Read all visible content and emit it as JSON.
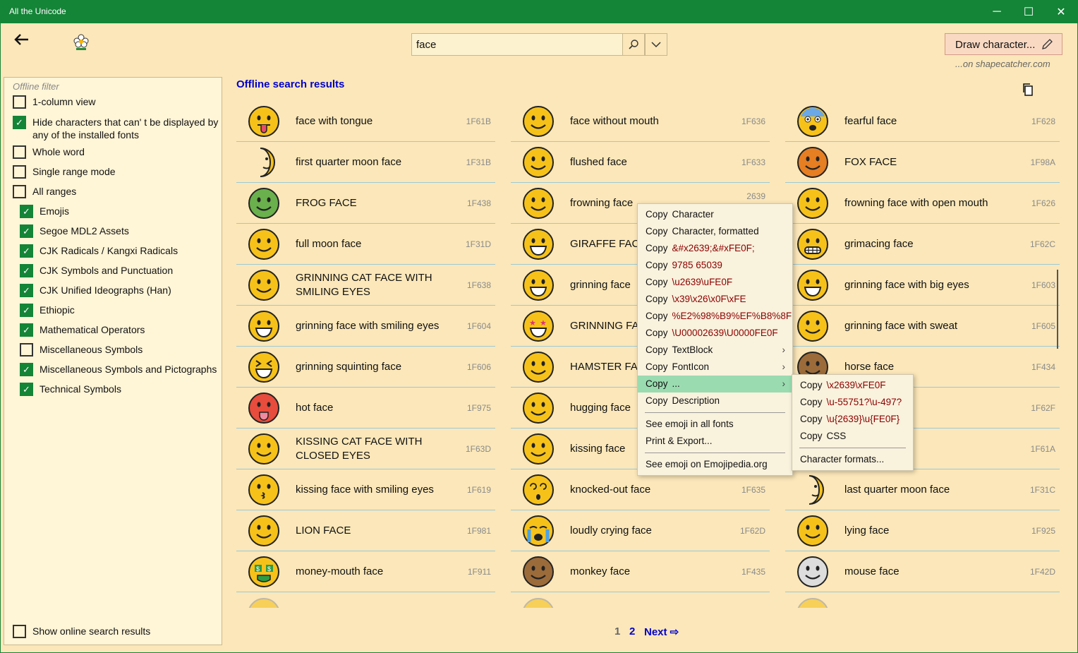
{
  "window": {
    "title": "All the Unicode"
  },
  "search": {
    "value": "face"
  },
  "draw": {
    "label": "Draw character...",
    "sub": "...on shapecatcher.com"
  },
  "filter": {
    "title": "Offline filter",
    "options": [
      {
        "label": "1-column view",
        "checked": false
      },
      {
        "label": "Hide characters that can' t be displayed by any of the installed fonts",
        "checked": true
      },
      {
        "label": "Whole word",
        "checked": false
      },
      {
        "label": "Single range mode",
        "checked": false
      },
      {
        "label": "All ranges",
        "checked": false
      }
    ],
    "ranges": [
      {
        "label": "Emojis",
        "checked": true
      },
      {
        "label": "Segoe MDL2 Assets",
        "checked": true
      },
      {
        "label": "CJK Radicals / Kangxi Radicals",
        "checked": true
      },
      {
        "label": "CJK Symbols and Punctuation",
        "checked": true
      },
      {
        "label": "CJK Unified Ideographs (Han)",
        "checked": true
      },
      {
        "label": "Ethiopic",
        "checked": true
      },
      {
        "label": "Mathematical Operators",
        "checked": true
      },
      {
        "label": "Miscellaneous Symbols",
        "checked": false
      },
      {
        "label": "Miscellaneous Symbols and Pictographs",
        "checked": true
      },
      {
        "label": "Technical Symbols",
        "checked": true
      }
    ],
    "online": {
      "label": "Show online search results",
      "checked": false
    }
  },
  "results": {
    "title": "Offline search results",
    "rows": [
      [
        [
          "face with tongue",
          "1F61B"
        ],
        [
          "face without mouth",
          "1F636"
        ],
        [
          "fearful face",
          "1F628"
        ]
      ],
      [
        [
          "first quarter moon face",
          "1F31B"
        ],
        [
          "flushed face",
          "1F633"
        ],
        [
          "FOX FACE",
          "1F98A"
        ]
      ],
      [
        [
          "FROG FACE",
          "1F438"
        ],
        [
          "frowning face",
          "2639"
        ],
        [
          "frowning face with open mouth",
          "1F626"
        ]
      ],
      [
        [
          "full moon face",
          "1F31D"
        ],
        [
          "GIRAFFE FACE",
          ""
        ],
        [
          "grimacing face",
          "1F62C"
        ]
      ],
      [
        [
          "GRINNING CAT FACE WITH SMILING EYES",
          "1F638"
        ],
        [
          "grinning face",
          ""
        ],
        [
          "grinning face with big eyes",
          "1F603"
        ]
      ],
      [
        [
          "grinning face with smiling eyes",
          "1F604"
        ],
        [
          "GRINNING FAC EYES",
          ""
        ],
        [
          "grinning face with sweat",
          "1F605"
        ]
      ],
      [
        [
          "grinning squinting face",
          "1F606"
        ],
        [
          "HAMSTER FAC",
          ""
        ],
        [
          "horse face",
          "1F434"
        ]
      ],
      [
        [
          "hot face",
          "1F975"
        ],
        [
          "hugging face",
          ""
        ],
        [
          "",
          "1F62F"
        ]
      ],
      [
        [
          "KISSING CAT FACE WITH CLOSED EYES",
          "1F63D"
        ],
        [
          "kissing face",
          ""
        ],
        [
          "h closed eyes",
          "1F61A"
        ]
      ],
      [
        [
          "kissing face with smiling eyes",
          "1F619"
        ],
        [
          "knocked-out face",
          "1F635"
        ],
        [
          "last quarter moon face",
          "1F31C"
        ]
      ],
      [
        [
          "LION FACE",
          "1F981"
        ],
        [
          "loudly crying face",
          "1F62D"
        ],
        [
          "lying face",
          "1F925"
        ]
      ],
      [
        [
          "money-mouth face",
          "1F911"
        ],
        [
          "monkey face",
          "1F435"
        ],
        [
          "mouse face",
          "1F42D"
        ]
      ]
    ]
  },
  "pager": {
    "p1": "1",
    "p2": "2",
    "next": "Next ⇨"
  },
  "context_menu": {
    "items": [
      {
        "k": "Copy",
        "v": "Character",
        "plain": true
      },
      {
        "k": "Copy",
        "v": "Character, formatted",
        "plain": true
      },
      {
        "k": "Copy",
        "v": "&#x2639;&#xFE0F;"
      },
      {
        "k": "Copy",
        "v": "9785 65039"
      },
      {
        "k": "Copy",
        "v": "\\u2639\\uFE0F"
      },
      {
        "k": "Copy",
        "v": "\\x39\\x26\\x0F\\xFE"
      },
      {
        "k": "Copy",
        "v": "%E2%98%B9%EF%B8%8F"
      },
      {
        "k": "Copy",
        "v": "\\U00002639\\U0000FE0F"
      },
      {
        "k": "Copy",
        "v": "TextBlock",
        "plain": true,
        "sub": true
      },
      {
        "k": "Copy",
        "v": "FontIcon",
        "plain": true,
        "sub": true
      },
      {
        "k": "Copy",
        "v": "...",
        "plain": true,
        "sub": true,
        "hl": true
      },
      {
        "k": "Copy",
        "v": "Description",
        "plain": true
      }
    ],
    "extra": [
      "See emoji in all fonts",
      "Print & Export..."
    ],
    "last": "See emoji on Emojipedia.org"
  },
  "submenu": {
    "items": [
      {
        "k": "Copy",
        "v": "\\x2639\\xFE0F"
      },
      {
        "k": "Copy",
        "v": "\\u-55751?\\u-497?"
      },
      {
        "k": "Copy",
        "v": "\\u{2639}\\u{FE0F}"
      },
      {
        "k": "Copy",
        "v": "CSS",
        "plain": true
      }
    ],
    "last": "Character formats..."
  },
  "colors": {
    "titlebar": "#148437",
    "accent": "#0000cd",
    "check": "#148437",
    "highlight": "#9adbb0"
  }
}
